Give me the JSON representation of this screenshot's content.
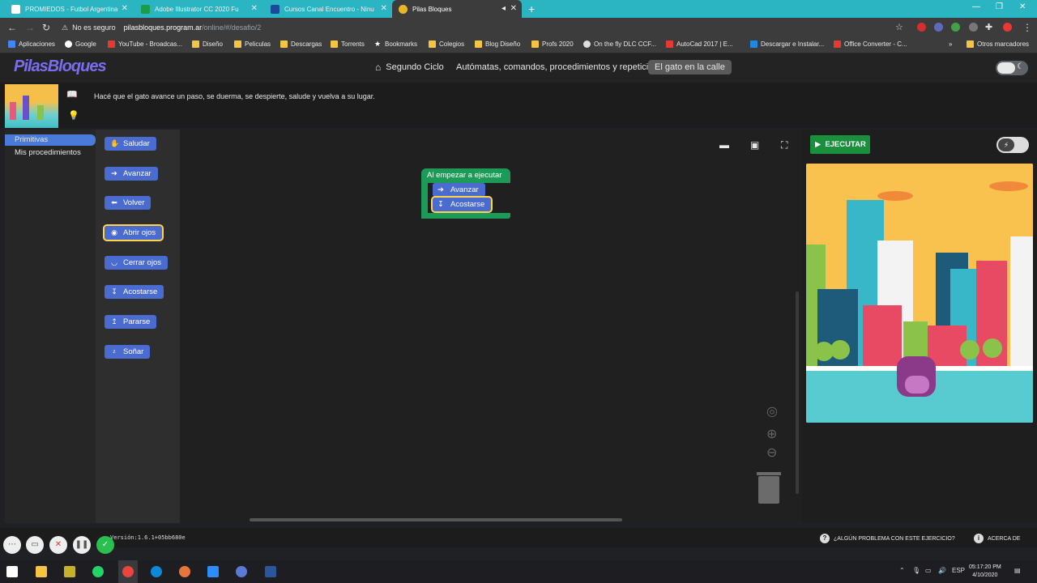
{
  "browser": {
    "tabs": [
      {
        "label": "PROMIEDOS - Futbol Argentina",
        "active": false
      },
      {
        "label": "Adobe Illustrator CC 2020 Fu",
        "active": false
      },
      {
        "label": "Cursos Canal Encuentro - Ninu",
        "active": false
      },
      {
        "label": "Pilas Bloques",
        "active": true
      }
    ],
    "address": {
      "security": "No es seguro",
      "domain": "pilasbloques.program.ar",
      "path": "/online/#/desafio/2"
    },
    "bookmarks": [
      "Aplicaciones",
      "Google",
      "YouTube - Broadcas...",
      "Diseño",
      "Peliculas",
      "Descargas",
      "Torrents",
      "Bookmarks",
      "Colegios",
      "Blog Diseño",
      "Profs 2020",
      "On the fly DLC CCF...",
      "AutoCad 2017 | E...",
      "Descargar e Instalar...",
      "Office Converter - C...",
      "Otros marcadores"
    ]
  },
  "header": {
    "logo": "PilasBloques",
    "breadcrumbs": [
      "Segundo Ciclo",
      "Autómatas, comandos, procedimientos y repetición",
      "El gato en la calle"
    ]
  },
  "challenge": {
    "description": "Hacé que el gato avance un paso, se duerma, se despierte, salude y vuelva a su lugar."
  },
  "toolbox": {
    "categories": [
      "Primitivas",
      "Mis procedimientos"
    ],
    "blocks": [
      {
        "label": "Saludar",
        "icon": "wave-icon"
      },
      {
        "label": "Avanzar",
        "icon": "arrow-right-icon"
      },
      {
        "label": "Volver",
        "icon": "arrow-left-icon"
      },
      {
        "label": "Abrir ojos",
        "icon": "eye-open-icon"
      },
      {
        "label": "Cerrar ojos",
        "icon": "eye-closed-icon"
      },
      {
        "label": "Acostarse",
        "icon": "lie-down-icon"
      },
      {
        "label": "Pararse",
        "icon": "stand-up-icon"
      },
      {
        "label": "Soñar",
        "icon": "zzz-icon"
      }
    ]
  },
  "workspace": {
    "program": {
      "hat": "Al empezar a ejecutar",
      "steps": [
        "Avanzar",
        "Acostarse"
      ]
    }
  },
  "stage": {
    "run_label": "EJECUTAR"
  },
  "footer": {
    "version": "Versión:1.6.1+05bb680e",
    "problem": "¿ALGÚN PROBLEMA CON ESTE EJERCICIO?",
    "about": "ACERCA DE"
  },
  "taskbar": {
    "lang": "ESP",
    "time": "05:17:20 PM",
    "date": "4/10/2020"
  }
}
